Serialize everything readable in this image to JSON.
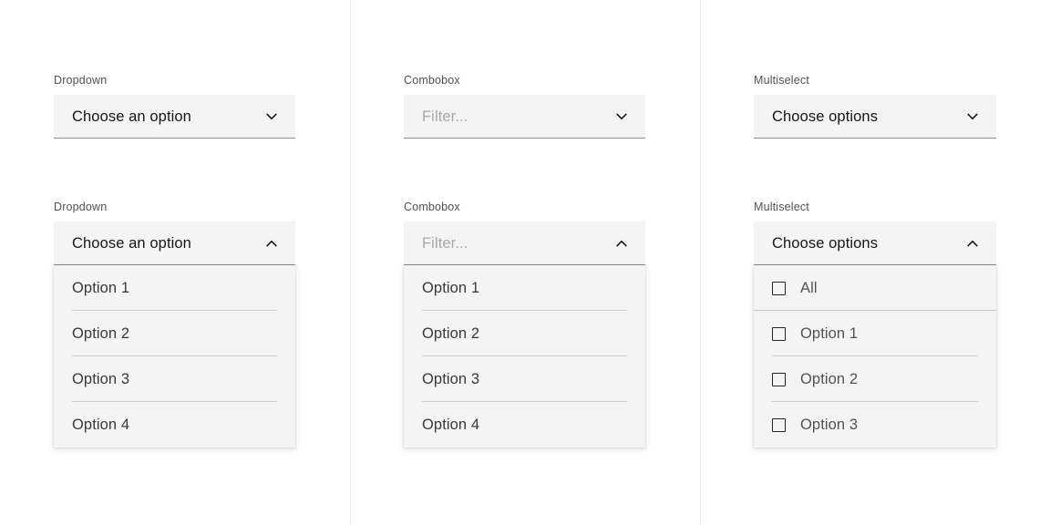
{
  "page": {
    "background": "#ffffff",
    "field_bg": "#f4f4f4",
    "field_underline": "#8d8d8d",
    "text_color": "#161616",
    "label_color": "#525252",
    "placeholder_color": "#a8a8a8",
    "divider_color": "#cfcfcf",
    "column_rule_color": "#e6e7e9"
  },
  "columns": [
    {
      "id": "dropdown",
      "closed": {
        "label": "Dropdown",
        "value": "Choose an option",
        "is_placeholder": false,
        "chevron": "chevron-down-icon",
        "expanded": false
      },
      "open": {
        "label": "Dropdown",
        "value": "Choose an option",
        "is_placeholder": false,
        "chevron": "chevron-up-icon",
        "expanded": true,
        "options": [
          {
            "label": "Option 1",
            "checkbox": false,
            "checked": false
          },
          {
            "label": "Option 2",
            "checkbox": false,
            "checked": false
          },
          {
            "label": "Option 3",
            "checkbox": false,
            "checked": false
          },
          {
            "label": "Option 4",
            "checkbox": false,
            "checked": false
          }
        ]
      }
    },
    {
      "id": "combobox",
      "closed": {
        "label": "Combobox",
        "value": "Filter...",
        "is_placeholder": true,
        "chevron": "chevron-down-icon",
        "expanded": false
      },
      "open": {
        "label": "Combobox",
        "value": "Filter...",
        "is_placeholder": true,
        "chevron": "chevron-up-icon",
        "expanded": true,
        "options": [
          {
            "label": "Option 1",
            "checkbox": false,
            "checked": false
          },
          {
            "label": "Option 2",
            "checkbox": false,
            "checked": false
          },
          {
            "label": "Option 3",
            "checkbox": false,
            "checked": false
          },
          {
            "label": "Option 4",
            "checkbox": false,
            "checked": false
          }
        ]
      }
    },
    {
      "id": "multiselect",
      "closed": {
        "label": "Multiselect",
        "value": "Choose options",
        "is_placeholder": false,
        "chevron": "chevron-down-icon",
        "expanded": false
      },
      "open": {
        "label": "Multiselect",
        "value": "Choose options",
        "is_placeholder": false,
        "chevron": "chevron-up-icon",
        "expanded": true,
        "options": [
          {
            "label": "All",
            "checkbox": true,
            "checked": false,
            "select_all": true
          },
          {
            "label": "Option 1",
            "checkbox": true,
            "checked": false
          },
          {
            "label": "Option 2",
            "checkbox": true,
            "checked": false
          },
          {
            "label": "Option 3",
            "checkbox": true,
            "checked": false
          }
        ]
      }
    }
  ]
}
